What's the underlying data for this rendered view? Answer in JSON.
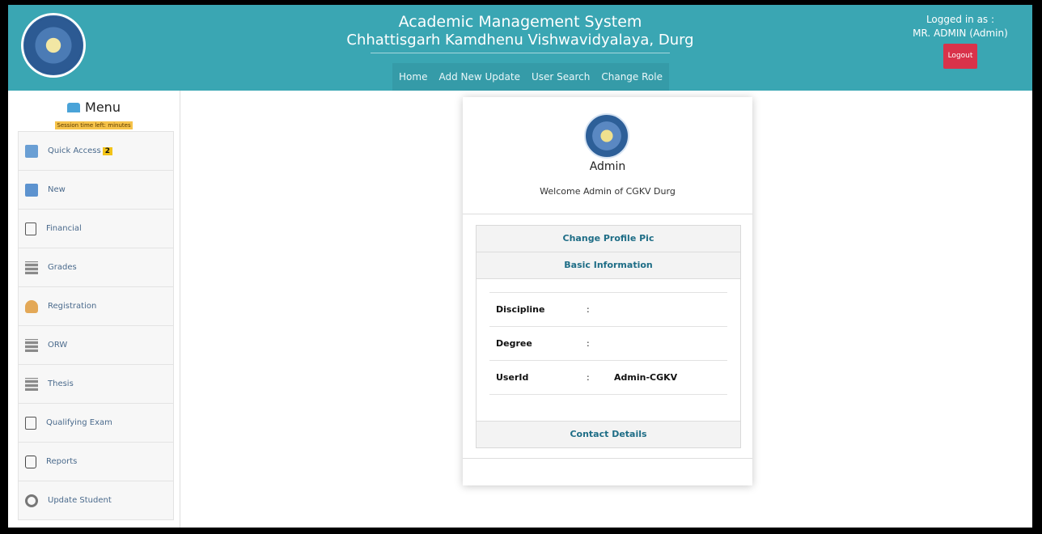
{
  "header": {
    "title_line1": "Academic Management System",
    "title_line2": "Chhattisgarh Kamdhenu Vishwavidyalaya, Durg",
    "nav": [
      "Home",
      "Add New Update",
      "User Search",
      "Change Role"
    ],
    "logged_in_label": "Logged in as :",
    "user_name": "MR. ADMIN (Admin)",
    "logout_label": "Logout",
    "color_primary": "#3aa6b3"
  },
  "sidebar": {
    "menu_title": "Menu",
    "session_text": "Session time left: minutes",
    "items": [
      {
        "label": "Quick Access",
        "icon": "quick-access-icon",
        "badge": "2"
      },
      {
        "label": "New",
        "icon": "new-document-icon"
      },
      {
        "label": "Financial",
        "icon": "financial-icon"
      },
      {
        "label": "Grades",
        "icon": "grades-icon"
      },
      {
        "label": "Registration",
        "icon": "registration-icon"
      },
      {
        "label": "ORW",
        "icon": "orw-icon"
      },
      {
        "label": "Thesis",
        "icon": "thesis-icon"
      },
      {
        "label": "Qualifying Exam",
        "icon": "qualifying-exam-icon"
      },
      {
        "label": "Reports",
        "icon": "reports-icon"
      },
      {
        "label": "Update Student",
        "icon": "update-student-icon"
      }
    ]
  },
  "profile": {
    "name": "Admin",
    "welcome": "Welcome Admin of CGKV Durg",
    "change_pic_label": "Change Profile Pic",
    "basic_info_label": "Basic Information",
    "rows": [
      {
        "label": "Discipline",
        "colon": ":",
        "value": ""
      },
      {
        "label": "Degree",
        "colon": ":",
        "value": ""
      },
      {
        "label": "UserId",
        "colon": ":",
        "value": "Admin-CGKV"
      }
    ],
    "contact_label": "Contact Details"
  }
}
